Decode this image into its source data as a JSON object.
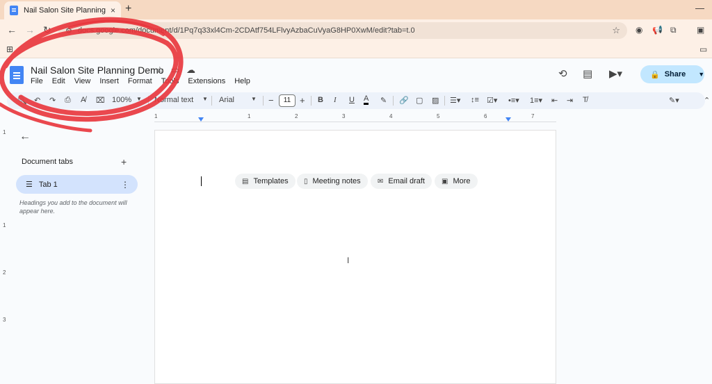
{
  "browser": {
    "tab_title": "Nail Salon Site Planning Demo",
    "tab_close": "×",
    "new_tab": "+",
    "url": "docs.google.com/document/d/1Pq7q33xl4Cm-2CDAtf754LFlvyAzbaCuVyaG8HP0XwM/edit?tab=t.0",
    "minimize": "—"
  },
  "doc": {
    "title": "Nail Salon Site Planning Demo",
    "menu": [
      "File",
      "Edit",
      "View",
      "Insert",
      "Format",
      "Tools",
      "Extensions",
      "Help"
    ],
    "share_label": "Share"
  },
  "toolbar": {
    "zoom": "100%",
    "style": "Normal text",
    "font": "Arial",
    "font_size": "11"
  },
  "ruler": {
    "numbers": [
      "1",
      "1",
      "2",
      "3",
      "4",
      "5",
      "6",
      "7"
    ]
  },
  "sidebar": {
    "heading": "Document tabs",
    "tab_label": "Tab 1",
    "hint": "Headings you add to the document will appear here."
  },
  "chips": {
    "templates": "Templates",
    "meeting_notes": "Meeting notes",
    "email_draft": "Email draft",
    "more": "More"
  },
  "colors": {
    "annotation": "#e8343b",
    "share_bg": "#c2e7ff",
    "tab_active_bg": "#d3e3fd",
    "docs_blue": "#4285f4"
  }
}
